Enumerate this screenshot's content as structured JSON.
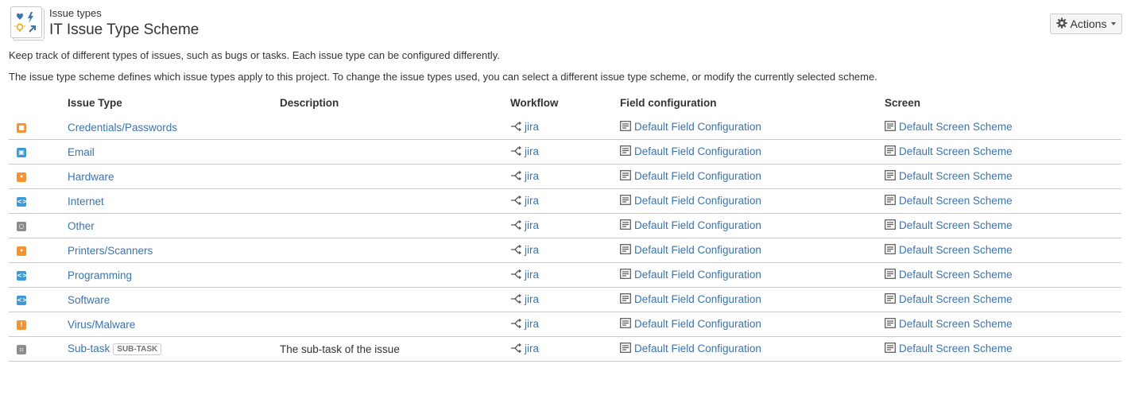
{
  "header": {
    "breadcrumb": "Issue types",
    "title": "IT Issue Type Scheme",
    "actions_label": "Actions"
  },
  "intro": {
    "line1": "Keep track of different types of issues, such as bugs or tasks. Each issue type can be configured differently.",
    "line2": "The issue type scheme defines which issue types apply to this project. To change the issue types used, you can select a different issue type scheme, or modify the currently selected scheme."
  },
  "table": {
    "columns": [
      "Issue Type",
      "Description",
      "Workflow",
      "Field configuration",
      "Screen"
    ],
    "rows": [
      {
        "name": "Credentials/Passwords",
        "icon": "lock-icon",
        "color": "#f79232",
        "description": "",
        "workflow": "jira",
        "field_config": "Default Field Configuration",
        "screen": "Default Screen Scheme"
      },
      {
        "name": "Email",
        "icon": "email-icon",
        "color": "#3b9bd8",
        "description": "",
        "workflow": "jira",
        "field_config": "Default Field Configuration",
        "screen": "Default Screen Scheme"
      },
      {
        "name": "Hardware",
        "icon": "lightbulb-icon",
        "color": "#f79232",
        "description": "",
        "workflow": "jira",
        "field_config": "Default Field Configuration",
        "screen": "Default Screen Scheme"
      },
      {
        "name": "Internet",
        "icon": "code-icon",
        "color": "#3b9bd8",
        "description": "",
        "workflow": "jira",
        "field_config": "Default Field Configuration",
        "screen": "Default Screen Scheme"
      },
      {
        "name": "Other",
        "icon": "circle-icon",
        "color": "#8c8c8c",
        "description": "",
        "workflow": "jira",
        "field_config": "Default Field Configuration",
        "screen": "Default Screen Scheme"
      },
      {
        "name": "Printers/Scanners",
        "icon": "lightbulb-icon",
        "color": "#f79232",
        "description": "",
        "workflow": "jira",
        "field_config": "Default Field Configuration",
        "screen": "Default Screen Scheme"
      },
      {
        "name": "Programming",
        "icon": "code-icon",
        "color": "#3b9bd8",
        "description": "",
        "workflow": "jira",
        "field_config": "Default Field Configuration",
        "screen": "Default Screen Scheme"
      },
      {
        "name": "Software",
        "icon": "code-icon",
        "color": "#3b9bd8",
        "description": "",
        "workflow": "jira",
        "field_config": "Default Field Configuration",
        "screen": "Default Screen Scheme"
      },
      {
        "name": "Virus/Malware",
        "icon": "exclamation-icon",
        "color": "#f79232",
        "description": "",
        "workflow": "jira",
        "field_config": "Default Field Configuration",
        "screen": "Default Screen Scheme"
      },
      {
        "name": "Sub-task",
        "icon": "subtask-icon",
        "color": "#8c8c8c",
        "badge": "SUB-TASK",
        "description": "The sub-task of the issue",
        "workflow": "jira",
        "field_config": "Default Field Configuration",
        "screen": "Default Screen Scheme"
      }
    ]
  }
}
